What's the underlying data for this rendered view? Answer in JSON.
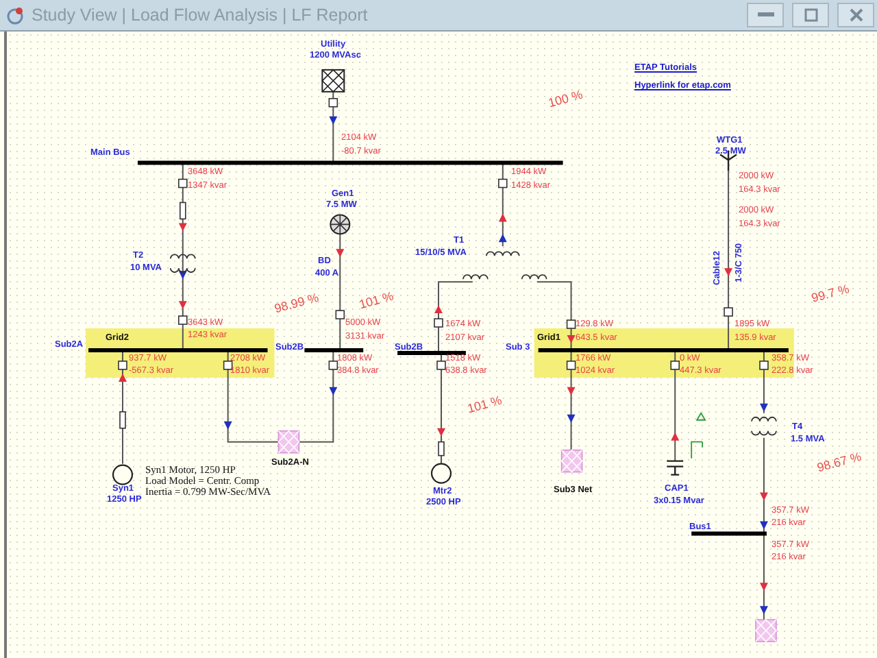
{
  "window": {
    "title": "Study View | Load Flow Analysis | LF Report"
  },
  "links": [
    "ETAP Tutorials",
    "Hyperlink for etap.com"
  ],
  "grids": [
    {
      "name": "Grid2"
    },
    {
      "name": "Grid1"
    }
  ],
  "labels": [
    {
      "text": "Utility",
      "kind": "element"
    },
    {
      "text": "1200 MVAsc",
      "kind": "element"
    },
    {
      "text": "Main Bus",
      "kind": "element"
    },
    {
      "text": "Gen1",
      "kind": "element"
    },
    {
      "text": "7.5 MW",
      "kind": "element"
    },
    {
      "text": "T2",
      "kind": "element"
    },
    {
      "text": "10 MVA",
      "kind": "element"
    },
    {
      "text": "BD",
      "kind": "element"
    },
    {
      "text": "400 A",
      "kind": "element"
    },
    {
      "text": "T1",
      "kind": "element"
    },
    {
      "text": "15/10/5 MVA",
      "kind": "element"
    },
    {
      "text": "WTG1",
      "kind": "element"
    },
    {
      "text": "2.5 MW",
      "kind": "element"
    },
    {
      "text": "Cable12",
      "kind": "vertical"
    },
    {
      "text": "1-3/C 750",
      "kind": "vertical"
    },
    {
      "text": "Sub2A",
      "kind": "element"
    },
    {
      "text": "Sub2B",
      "kind": "element"
    },
    {
      "text": "Sub2B",
      "kind": "element"
    },
    {
      "text": "Sub 3",
      "kind": "element"
    },
    {
      "text": "Sub2A-N",
      "kind": "tag"
    },
    {
      "text": "Syn1",
      "kind": "element"
    },
    {
      "text": "1250 HP",
      "kind": "element"
    },
    {
      "text": "Mtr2",
      "kind": "element"
    },
    {
      "text": "2500 HP",
      "kind": "element"
    },
    {
      "text": "Sub3 Net",
      "kind": "tag"
    },
    {
      "text": "CAP1",
      "kind": "element"
    },
    {
      "text": "3x0.15 Mvar",
      "kind": "element"
    },
    {
      "text": "T4",
      "kind": "element"
    },
    {
      "text": "1.5 MVA",
      "kind": "element"
    },
    {
      "text": "Bus1",
      "kind": "element"
    },
    {
      "text": "Syn1 Motor, 1250 HP",
      "kind": "note"
    },
    {
      "text": "Load Model = Centr. Comp",
      "kind": "note"
    },
    {
      "text": "Inertia = 0.799 MW-Sec/MVA",
      "kind": "note"
    },
    {
      "text": "2104 kW",
      "kind": "flow"
    },
    {
      "text": "-80.7 kvar",
      "kind": "flow"
    },
    {
      "text": "3648 kW",
      "kind": "flow"
    },
    {
      "text": "1347 kvar",
      "kind": "flow"
    },
    {
      "text": "1944 kW",
      "kind": "flow"
    },
    {
      "text": "1428 kvar",
      "kind": "flow"
    },
    {
      "text": "2000 kW",
      "kind": "flow"
    },
    {
      "text": "164.3 kvar",
      "kind": "flow"
    },
    {
      "text": "2000 kW",
      "kind": "flow"
    },
    {
      "text": "164.3 kvar",
      "kind": "flow"
    },
    {
      "text": "3643 kW",
      "kind": "flow"
    },
    {
      "text": "1243 kvar",
      "kind": "flow"
    },
    {
      "text": "5000 kW",
      "kind": "flow"
    },
    {
      "text": "3131 kvar",
      "kind": "flow"
    },
    {
      "text": "1674 kW",
      "kind": "flow"
    },
    {
      "text": "2107 kvar",
      "kind": "flow"
    },
    {
      "text": "129.8 kW",
      "kind": "flow"
    },
    {
      "text": "643.5 kvar",
      "kind": "flow"
    },
    {
      "text": "1895 kW",
      "kind": "flow"
    },
    {
      "text": "135.9 kvar",
      "kind": "flow"
    },
    {
      "text": "937.7 kW",
      "kind": "flow"
    },
    {
      "text": "-567.3 kvar",
      "kind": "flow"
    },
    {
      "text": "2708 kW",
      "kind": "flow"
    },
    {
      "text": "1810 kvar",
      "kind": "flow"
    },
    {
      "text": "1808 kW",
      "kind": "flow"
    },
    {
      "text": "384.8 kvar",
      "kind": "flow"
    },
    {
      "text": "1518 kW",
      "kind": "flow"
    },
    {
      "text": "638.8 kvar",
      "kind": "flow"
    },
    {
      "text": "1766 kW",
      "kind": "flow"
    },
    {
      "text": "1024 kvar",
      "kind": "flow"
    },
    {
      "text": "0 kW",
      "kind": "flow"
    },
    {
      "text": "447.3 kvar",
      "kind": "flow"
    },
    {
      "text": "358.7 kW",
      "kind": "flow"
    },
    {
      "text": "222.8 kvar",
      "kind": "flow"
    },
    {
      "text": "357.7 kW",
      "kind": "flow"
    },
    {
      "text": "216 kvar",
      "kind": "flow"
    },
    {
      "text": "357.7 kW",
      "kind": "flow"
    },
    {
      "text": "216 kvar",
      "kind": "flow"
    },
    {
      "text": "100 %",
      "kind": "voltage"
    },
    {
      "text": "98.99 %",
      "kind": "voltage"
    },
    {
      "text": "101 %",
      "kind": "voltage"
    },
    {
      "text": "99.7 %",
      "kind": "voltage"
    },
    {
      "text": "101 %",
      "kind": "voltage"
    },
    {
      "text": "98.67 %",
      "kind": "voltage"
    }
  ]
}
